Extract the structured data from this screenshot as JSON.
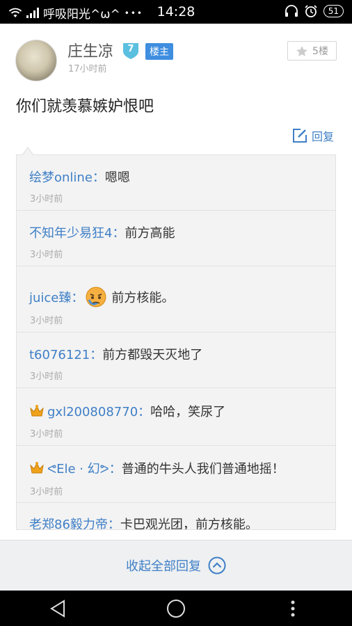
{
  "status_bar": {
    "carrier": "呼吸阳光^ω^",
    "dots": "•••",
    "time": "14:28",
    "battery": "51",
    "icons": [
      "wifi-icon",
      "signal-icon",
      "headphones-icon",
      "alarm-icon",
      "battery-icon"
    ]
  },
  "post": {
    "username": "庄生凉",
    "level": "7",
    "owner_badge": "楼主",
    "time": "17小时前",
    "floor": "5楼",
    "content": "你们就羡慕嫉妒恨吧",
    "reply_label": "回复"
  },
  "replies": [
    {
      "name": "绘梦online：",
      "text": "嗯嗯",
      "time": "3小时前",
      "crown": false,
      "emoji": false
    },
    {
      "name": "不知年少易狂4：",
      "text": "前方高能",
      "time": "3小时前",
      "crown": false,
      "emoji": false
    },
    {
      "name": "juice臻：",
      "text": "前方核能。",
      "time": "3小时前",
      "crown": false,
      "emoji": true
    },
    {
      "name": "t6076121：",
      "text": "前方都毁天灭地了",
      "time": "3小时前",
      "crown": false,
      "emoji": false
    },
    {
      "name": "gxl200808770：",
      "text": "哈哈，笑尿了",
      "time": "3小时前",
      "crown": true,
      "emoji": false
    },
    {
      "name": "ᕙEle · 幻ᕗ：",
      "text": "普通的牛头人我们普通地摇！",
      "time": "3小时前",
      "crown": true,
      "emoji": false
    },
    {
      "name": "老郑86毅力帝：",
      "text": "卡巴观光团，前方核能。",
      "time": "",
      "crown": false,
      "emoji": false
    }
  ],
  "collapse_label": "收起全部回复",
  "colors": {
    "accent": "#3f7fc6",
    "badge": "#3f8ee0",
    "level": "#5bbfe0"
  }
}
